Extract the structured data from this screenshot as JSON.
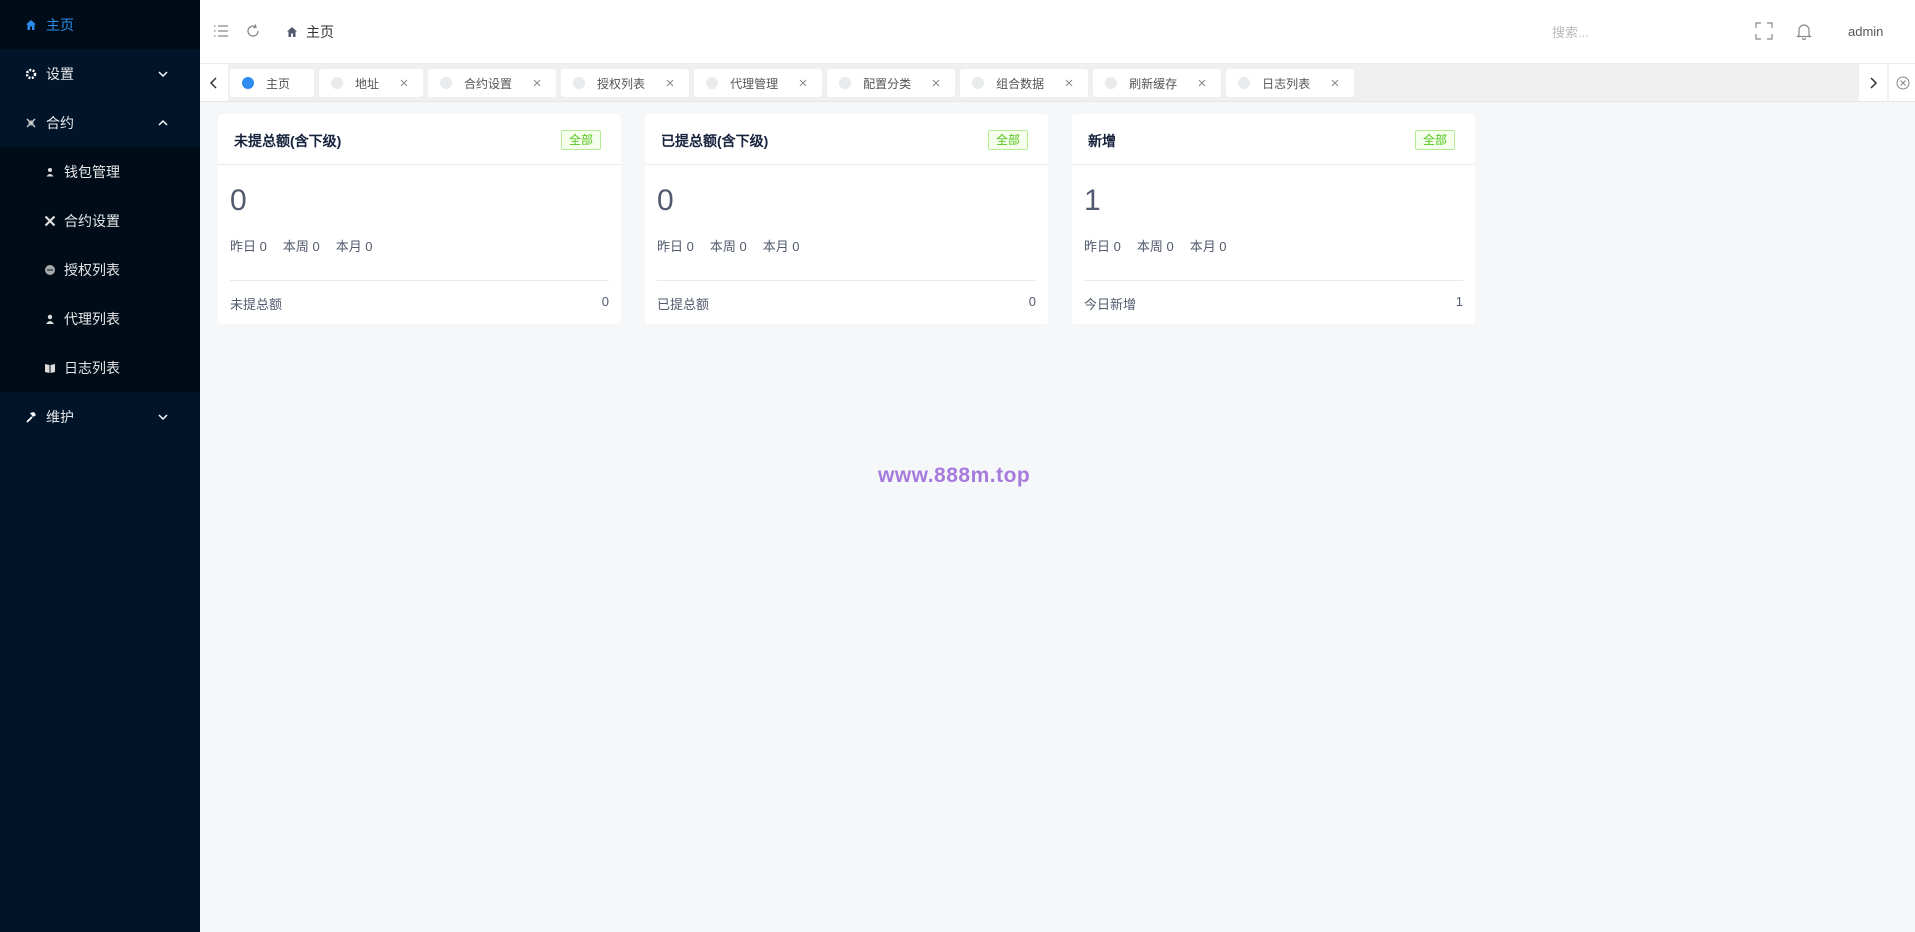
{
  "sidebar": {
    "items": [
      {
        "label": "主页",
        "icon": "home-icon"
      },
      {
        "label": "设置",
        "icon": "gear-icon"
      },
      {
        "label": "合约",
        "icon": "contract-icon"
      }
    ],
    "contract_sub": [
      {
        "label": "钱包管理",
        "icon": "user-icon"
      },
      {
        "label": "合约设置",
        "icon": "tools-icon"
      },
      {
        "label": "授权列表",
        "icon": "circle-icon"
      },
      {
        "label": "代理列表",
        "icon": "person-icon"
      },
      {
        "label": "日志列表",
        "icon": "book-icon"
      }
    ],
    "maintain": {
      "label": "维护",
      "icon": "hammer-icon"
    },
    "colors": {
      "bg": "#001529",
      "active": "#2d8cf0"
    }
  },
  "header": {
    "breadcrumb": "主页",
    "search_placeholder": "搜索...",
    "user": "admin"
  },
  "tabs": [
    {
      "label": "主页",
      "active": true
    },
    {
      "label": "地址"
    },
    {
      "label": "合约设置"
    },
    {
      "label": "授权列表"
    },
    {
      "label": "代理管理"
    },
    {
      "label": "配置分类"
    },
    {
      "label": "组合数据"
    },
    {
      "label": "刷新缓存"
    },
    {
      "label": "日志列表"
    }
  ],
  "cards": [
    {
      "title": "未提总额(含下级)",
      "tag": "全部",
      "number": "0",
      "yesterday": "昨日 0",
      "week": "本周 0",
      "month": "本月 0",
      "footer_label": "未提总额",
      "footer_value": "0"
    },
    {
      "title": "已提总额(含下级)",
      "tag": "全部",
      "number": "0",
      "yesterday": "昨日 0",
      "week": "本周 0",
      "month": "本月 0",
      "footer_label": "已提总额",
      "footer_value": "0"
    },
    {
      "title": "新增",
      "tag": "全部",
      "number": "1",
      "yesterday": "昨日 0",
      "week": "本周 0",
      "month": "本月 0",
      "footer_label": "今日新增",
      "footer_value": "1"
    }
  ],
  "watermark": "www.888m.top"
}
